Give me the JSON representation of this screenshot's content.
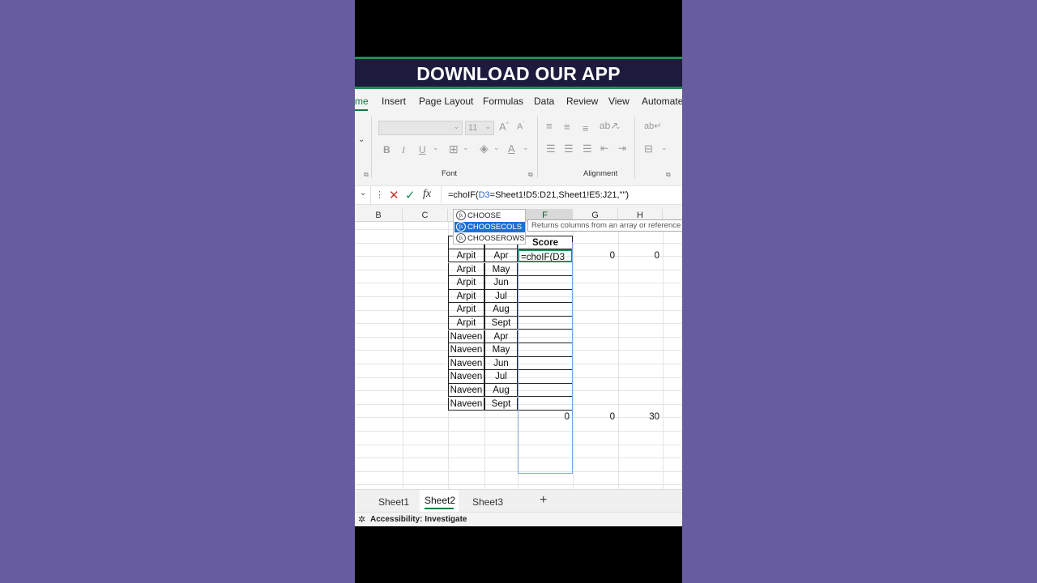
{
  "banner": {
    "text": "DOWNLOAD OUR APP"
  },
  "ribbon": {
    "tabs": [
      "me",
      "Insert",
      "Page Layout",
      "Formulas",
      "Data",
      "Review",
      "View",
      "Automate"
    ],
    "font_size_value": "11",
    "groups": {
      "font": "Font",
      "alignment": "Alignment"
    },
    "glyphs": {
      "bold": "B",
      "italic": "I",
      "underline": "U",
      "grow": "A",
      "shrink": "A",
      "color": "A"
    }
  },
  "formula_bar": {
    "prefix": "=choIF(",
    "ref": "D3",
    "suffix": "=Sheet1!D5:D21,Sheet1!E5:J21,\"\")"
  },
  "columns": {
    "B": "B",
    "C": "C",
    "F": "F",
    "G": "G",
    "H": "H"
  },
  "table": {
    "header": "Score",
    "rows": [
      {
        "name": "Arpit",
        "month": "Apr"
      },
      {
        "name": "Arpit",
        "month": "May"
      },
      {
        "name": "Arpit",
        "month": "Jun"
      },
      {
        "name": "Arpit",
        "month": "Jul"
      },
      {
        "name": "Arpit",
        "month": "Aug"
      },
      {
        "name": "Arpit",
        "month": "Sept"
      },
      {
        "name": "Naveen",
        "month": "Apr"
      },
      {
        "name": "Naveen",
        "month": "May"
      },
      {
        "name": "Naveen",
        "month": "Jun"
      },
      {
        "name": "Naveen",
        "month": "Jul"
      },
      {
        "name": "Naveen",
        "month": "Aug"
      },
      {
        "name": "Naveen",
        "month": "Sept"
      }
    ],
    "editing_text": "=choIF(D3",
    "row1_values": {
      "G": "0",
      "H": "0"
    },
    "bottom_values": {
      "F": "0",
      "G": "0",
      "H": "30"
    }
  },
  "autocomplete": {
    "items": [
      "CHOOSE",
      "CHOOSECOLS",
      "CHOOSEROWS"
    ],
    "selected_index": 1,
    "tooltip": "Returns columns from an array or reference"
  },
  "sheets": {
    "tabs": [
      "Sheet1",
      "Sheet2",
      "Sheet3"
    ],
    "active": "Sheet2",
    "add_label": "+"
  },
  "status": {
    "text": "Accessibility: Investigate"
  }
}
